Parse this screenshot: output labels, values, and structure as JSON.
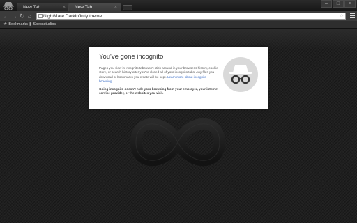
{
  "tabs": [
    {
      "title": "New Tab"
    },
    {
      "title": "New Tab"
    }
  ],
  "omnibox": {
    "text": "NightMare DarkInfinity theme"
  },
  "bookmarks": [
    {
      "label": "Bookmarks"
    },
    {
      "label": "Specsstudios"
    }
  ],
  "incognito": {
    "heading": "You've gone incognito",
    "body": "Pages you view in incognito tabs won't stick around in your browser's history, cookie store, or search history after you've closed all of your incognito tabs. Any files you download or bookmarks you create will be kept.",
    "learn_more": "Learn more about incognito browsing",
    "warning": "Going incognito doesn't hide your browsing from your employer, your internet service provider, or the websites you visit."
  },
  "icons": {
    "back": "arrow-left",
    "forward": "arrow-right",
    "reload": "reload",
    "home": "home",
    "bookmark_star": "star",
    "menu": "hamburger",
    "incognito": "spy-hat-glasses",
    "theme_logo": "infinity"
  },
  "colors": {
    "accent_link": "#3b6ec7",
    "card_bg": "#ffffff",
    "page_bg": "#1f1f1f"
  }
}
